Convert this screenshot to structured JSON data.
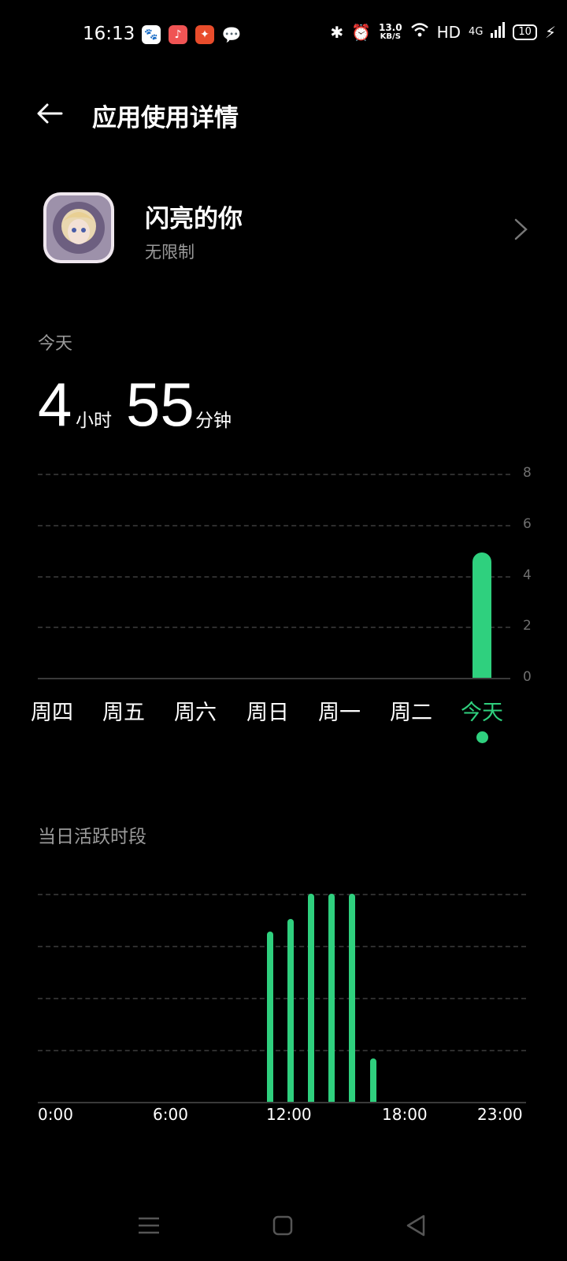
{
  "status_bar": {
    "time": "16:13",
    "apps": [
      "baidu-icon",
      "music-icon",
      "game-icon",
      "wechat-icon"
    ],
    "net_speed_value": "13.0",
    "net_speed_unit": "KB/S",
    "network": "HD",
    "signal": "4G",
    "battery": "10"
  },
  "header": {
    "title": "应用使用详情"
  },
  "app": {
    "name": "闪亮的你",
    "limit": "无限制"
  },
  "today": {
    "label": "今天",
    "hours": "4",
    "hours_unit": "小时",
    "minutes": "55",
    "minutes_unit": "分钟"
  },
  "hourly": {
    "label": "当日活跃时段"
  },
  "colors": {
    "accent": "#2fd07e",
    "background": "#000000",
    "secondary_text": "#9a9a9a"
  },
  "chart_data": [
    {
      "type": "bar",
      "categories": [
        "周四",
        "周五",
        "周六",
        "周日",
        "周一",
        "周二",
        "今天"
      ],
      "values": [
        0,
        0,
        0,
        0,
        0,
        0,
        4.92
      ],
      "yticks": [
        "8",
        "6",
        "4",
        "2",
        "0"
      ],
      "ylim": [
        0,
        8
      ],
      "selected": "今天",
      "grid": true
    },
    {
      "type": "bar",
      "xticks": [
        "0:00",
        "6:00",
        "12:00",
        "18:00",
        "23:00"
      ],
      "hours": [
        11,
        12,
        13,
        14,
        15,
        16
      ],
      "values": [
        0.82,
        0.88,
        1.0,
        1.0,
        1.0,
        0.21
      ],
      "ylim": [
        0,
        1
      ],
      "grid": true
    }
  ]
}
